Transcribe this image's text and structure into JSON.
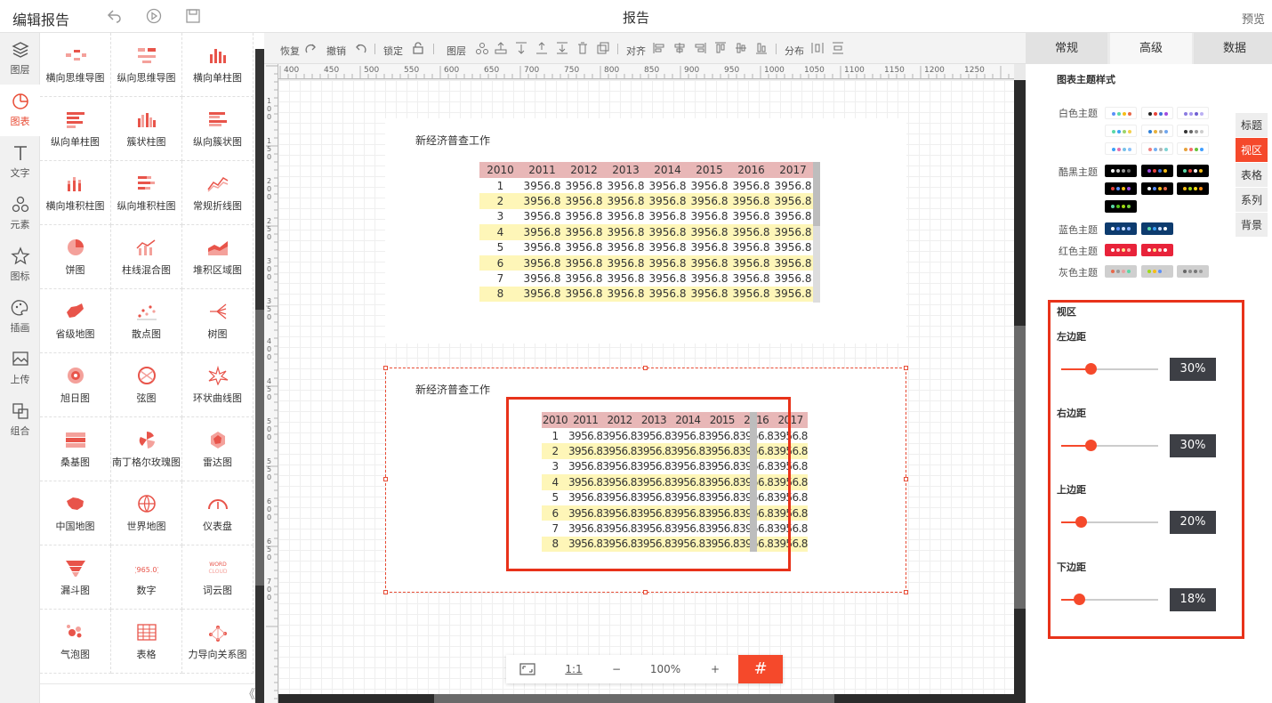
{
  "topbar": {
    "title": "编辑报告",
    "center_title": "报告",
    "preview": "预览"
  },
  "leftnav": [
    {
      "label": "图层",
      "icon": "layers-icon"
    },
    {
      "label": "图表",
      "icon": "chart-pie-icon",
      "active": true
    },
    {
      "label": "文字",
      "icon": "text-icon"
    },
    {
      "label": "元素",
      "icon": "shapes-icon"
    },
    {
      "label": "图标",
      "icon": "star-icon"
    },
    {
      "label": "插画",
      "icon": "palette-icon"
    },
    {
      "label": "上传",
      "icon": "image-upload-icon"
    },
    {
      "label": "组合",
      "icon": "group-icon"
    }
  ],
  "palette": [
    "横向思维导图",
    "纵向思维导图",
    "横向单柱图",
    "纵向单柱图",
    "簇状柱图",
    "纵向簇状图",
    "横向堆积柱图",
    "纵向堆积柱图",
    "常规折线图",
    "饼图",
    "柱线混合图",
    "堆积区域图",
    "省级地图",
    "散点图",
    "树图",
    "旭日图",
    "弦图",
    "环状曲线图",
    "桑基图",
    "南丁格尔玫瑰图",
    "雷达图",
    "中国地图",
    "世界地图",
    "仪表盘",
    "漏斗图",
    "数字",
    "词云图",
    "气泡图",
    "表格",
    "力导向关系图"
  ],
  "toolbar": {
    "redo": "恢复",
    "undo": "撤销",
    "lock": "锁定",
    "layer": "图层",
    "align": "对齐",
    "distribute": "分布"
  },
  "ruler": [
    "400",
    "450",
    "500",
    "550",
    "600",
    "650",
    "700",
    "750",
    "800",
    "850",
    "900",
    "950",
    "1000",
    "1050",
    "1100",
    "1150",
    "1200",
    "1250"
  ],
  "ruler_v": [
    "100",
    "150",
    "200",
    "250",
    "300",
    "350",
    "400",
    "450",
    "500",
    "550",
    "600",
    "650",
    "700"
  ],
  "chart1": {
    "title": "新经济普查工作"
  },
  "chart2": {
    "title": "新经济普查工作"
  },
  "chart_data": {
    "type": "table",
    "columns": [
      "2010",
      "2011",
      "2012",
      "2013",
      "2014",
      "2015",
      "2016",
      "2017"
    ],
    "rows": [
      [
        "1",
        "3956.8",
        "3956.8",
        "3956.8",
        "3956.8",
        "3956.8",
        "3956.8",
        "3956.8"
      ],
      [
        "2",
        "3956.8",
        "3956.8",
        "3956.8",
        "3956.8",
        "3956.8",
        "3956.8",
        "3956.8"
      ],
      [
        "3",
        "3956.8",
        "3956.8",
        "3956.8",
        "3956.8",
        "3956.8",
        "3956.8",
        "3956.8"
      ],
      [
        "4",
        "3956.8",
        "3956.8",
        "3956.8",
        "3956.8",
        "3956.8",
        "3956.8",
        "3956.8"
      ],
      [
        "5",
        "3956.8",
        "3956.8",
        "3956.8",
        "3956.8",
        "3956.8",
        "3956.8",
        "3956.8"
      ],
      [
        "6",
        "3956.8",
        "3956.8",
        "3956.8",
        "3956.8",
        "3956.8",
        "3956.8",
        "3956.8"
      ],
      [
        "7",
        "3956.8",
        "3956.8",
        "3956.8",
        "3956.8",
        "3956.8",
        "3956.8",
        "3956.8"
      ],
      [
        "8",
        "3956.8",
        "3956.8",
        "3956.8",
        "3956.8",
        "3956.8",
        "3956.8",
        "3956.8"
      ]
    ],
    "header_color": "#e8b7b7",
    "stripe_color": "#fef6b8"
  },
  "zoom": {
    "fit": "fit-screen-icon",
    "ratio": "1:1",
    "minus": "−",
    "value": "100%",
    "plus": "+",
    "grid": "#"
  },
  "rpanel": {
    "tabs": [
      "常规",
      "高级",
      "数据"
    ],
    "active_tab": 1,
    "theme_title": "图表主题样式",
    "themes": [
      {
        "label": "白色主题",
        "bg": "#ffffff"
      },
      {
        "label": "酷黑主题",
        "bg": "#000000"
      },
      {
        "label": "蓝色主题",
        "bg": "#0d3b6e"
      },
      {
        "label": "红色主题",
        "bg": "#e8233a"
      },
      {
        "label": "灰色主题",
        "bg": "#cfcfcf"
      }
    ],
    "side_tabs": [
      "标题",
      "视区",
      "表格",
      "系列",
      "背景"
    ],
    "active_side": 1,
    "viewport_title": "视区",
    "margins": [
      {
        "label": "左边距",
        "value": "30%",
        "level": 0.3
      },
      {
        "label": "右边距",
        "value": "30%",
        "level": 0.3
      },
      {
        "label": "上边距",
        "value": "20%",
        "level": 0.2
      },
      {
        "label": "下边距",
        "value": "18%",
        "level": 0.18
      }
    ]
  },
  "colors": {
    "accent": "#f5492b",
    "highlight": "#e8321a"
  }
}
